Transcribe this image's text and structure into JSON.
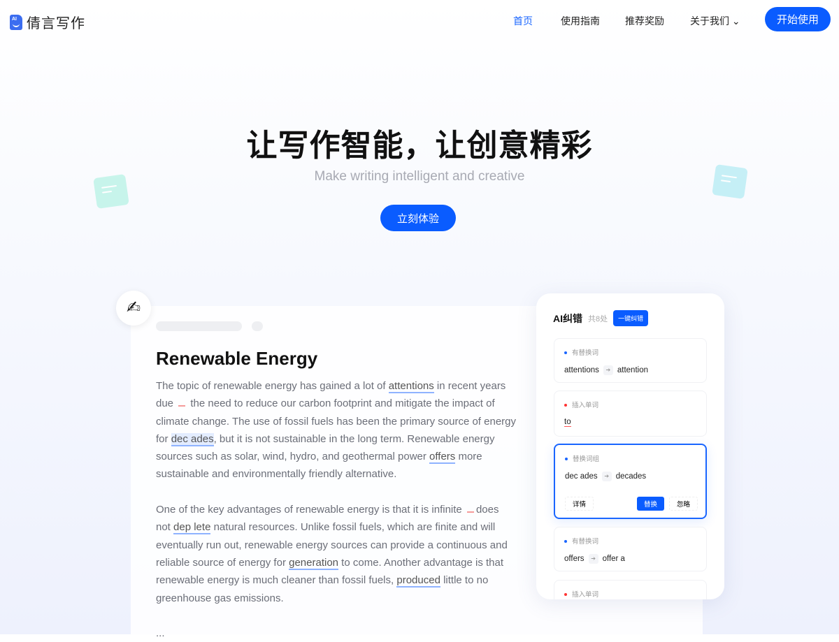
{
  "nav": {
    "logo_text": "倩言写作",
    "logo_badge": "AI",
    "items": [
      {
        "label": "首页",
        "active": true
      },
      {
        "label": "使用指南"
      },
      {
        "label": "推荐奖励"
      },
      {
        "label": "关于我们 ⌄"
      }
    ],
    "start": "开始使用"
  },
  "hero": {
    "title": "让写作智能，让创意精彩",
    "subtitle": "Make writing intelligent and creative",
    "cta": "立刻体验"
  },
  "article": {
    "pen_icon": "✍",
    "title": "Renewable Energy",
    "paragraphs": [
      [
        {
          "t": "The topic of renewable energy has gained a lot of "
        },
        {
          "t": "attentions",
          "k": "hl"
        },
        {
          "t": " in recent years due "
        },
        {
          "t": "",
          "k": "gap"
        },
        {
          "t": " the need to reduce our carbon footprint and mitigate the impact of climate change. The use of fossil fuels has been the primary source of energy for "
        },
        {
          "t": "dec ades",
          "k": "hlb"
        },
        {
          "t": ", but it is not sustainable in the long term. Renewable energy sources such as solar, wind, hydro, and geothermal power "
        },
        {
          "t": "offers",
          "k": "hl"
        },
        {
          "t": " more sustainable and environmentally friendly alternative."
        }
      ],
      [
        {
          "t": "One of the key advantages of renewable energy is that it is infinite "
        },
        {
          "t": "",
          "k": "gap"
        },
        {
          "t": "does not "
        },
        {
          "t": "dep lete",
          "k": "hl"
        },
        {
          "t": " natural resources. Unlike fossil fuels, which are finite and will eventually run out, renewable energy sources can provide a continuous and reliable source of energy for "
        },
        {
          "t": "generation",
          "k": "hl"
        },
        {
          "t": " to come. Another advantage is that renewable energy is much cleaner than fossil fuels, "
        },
        {
          "t": "produced",
          "k": "hl"
        },
        {
          "t": " little to no greenhouse gas emissions."
        }
      ]
    ],
    "ellipsis": "..."
  },
  "panel": {
    "title": "AI纠错",
    "count": "共8处",
    "fix_all": "一键纠错",
    "items": [
      {
        "type": "有替换词",
        "dot": "#1a66ff",
        "from": "attentions",
        "to": "attention"
      },
      {
        "type": "插入单词",
        "dot": "#f33",
        "insert": "to"
      },
      {
        "type": "替换词组",
        "dot": "#1a66ff",
        "from": "dec ades",
        "to": "decades",
        "selected": true,
        "details": "详情",
        "replace": "替换",
        "ignore": "忽略"
      },
      {
        "type": "有替换词",
        "dot": "#1a66ff",
        "from": "offers",
        "to": "offer a"
      },
      {
        "type": "插入单词",
        "dot": "#f33"
      }
    ]
  }
}
